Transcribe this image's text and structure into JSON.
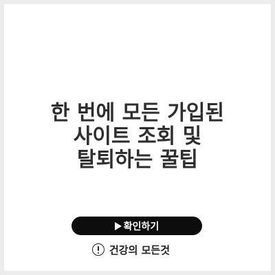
{
  "headline": {
    "lines": [
      "한 번에 모든 가입된",
      "사이트 조회 및",
      "탈퇴하는 꿀팁"
    ]
  },
  "cta": {
    "label": "확인하기",
    "icon": "play-icon"
  },
  "brand": {
    "name": "건강의 모든것",
    "icon": "exclamation-circle-icon"
  },
  "colors": {
    "page_background": "#ececec",
    "card_background": "#ffffff",
    "headline_text": "#2e2e2e",
    "button_background": "#0d0d0d",
    "button_text": "#ffffff"
  }
}
